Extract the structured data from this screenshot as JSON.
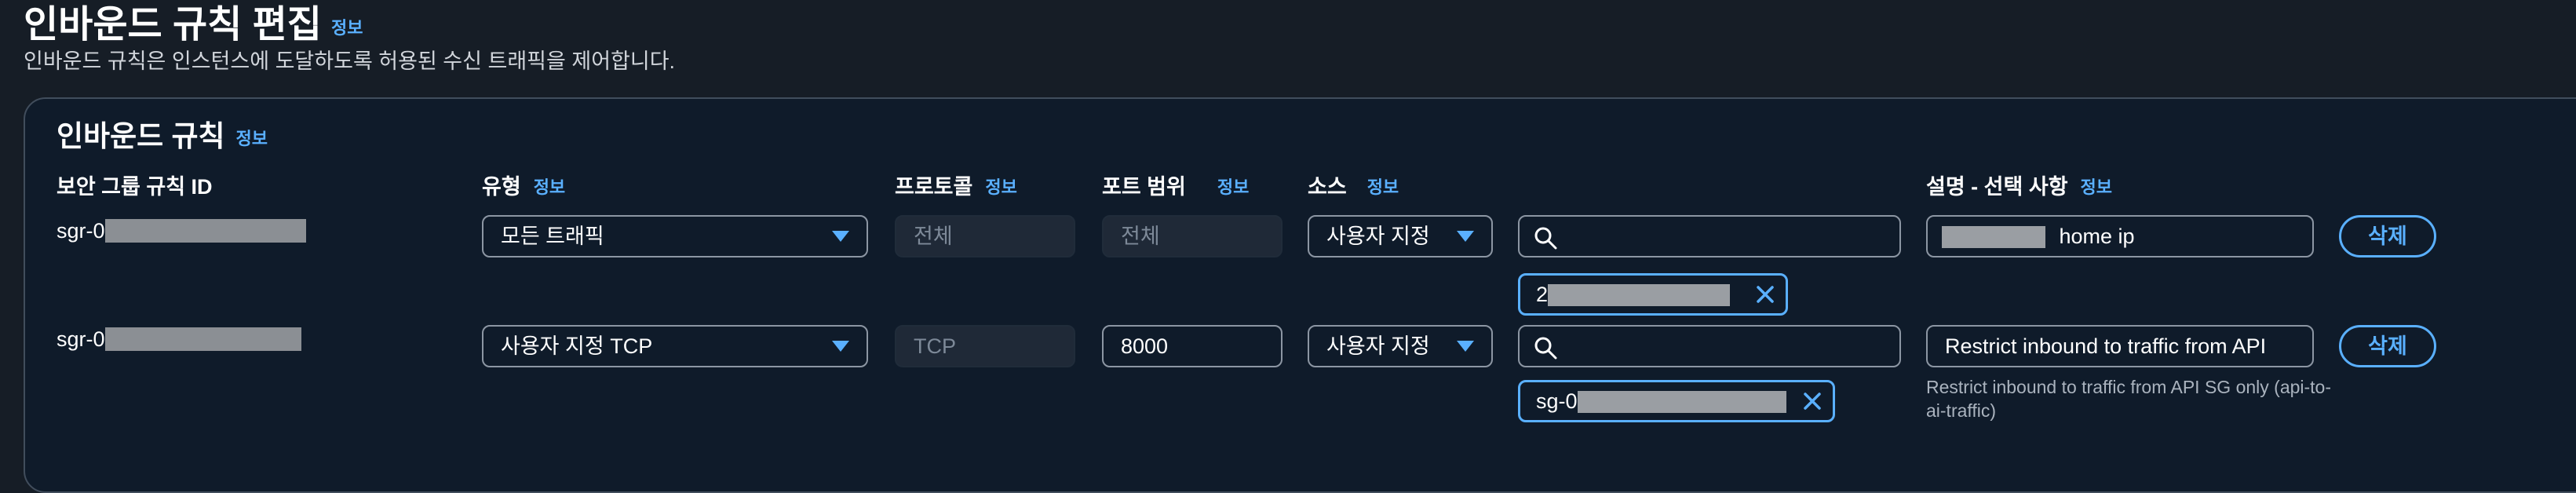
{
  "page": {
    "title": "인바운드 규칙 편집",
    "info": "정보",
    "description": "인바운드 규칙은 인스턴스에 도달하도록 허용된 수신 트래픽을 제어합니다."
  },
  "panel": {
    "title": "인바운드 규칙",
    "info": "정보"
  },
  "columns": {
    "rule_id": "보안 그룹 규칙 ID",
    "type": "유형",
    "protocol": "프로토콜",
    "port_range": "포트 범위",
    "source": "소스",
    "description": "설명 - 선택 사항",
    "info": "정보"
  },
  "rules": [
    {
      "rule_id_prefix": "sgr-0",
      "type": "모든 트래픽",
      "protocol": "전체",
      "port_range": "전체",
      "source": "사용자 지정",
      "search_value": "",
      "token": "2",
      "description_visible": "home ip",
      "delete": "삭제"
    },
    {
      "rule_id_prefix": "sgr-0",
      "type": "사용자 지정 TCP",
      "protocol": "TCP",
      "port_range": "8000",
      "source": "사용자 지정",
      "search_value": "",
      "token": "sg-0",
      "description": "Restrict inbound to traffic from API",
      "help_text": "Restrict inbound to traffic from API SG only (api-to-ai-traffic)",
      "delete": "삭제"
    }
  ],
  "icons": [
    "search-icon",
    "close-icon",
    "caret-down-icon"
  ],
  "colors": {
    "accent": "#5ab0ff",
    "background": "#161d26",
    "panel": "#0f1b2a"
  }
}
